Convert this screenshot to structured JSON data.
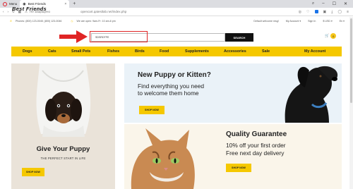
{
  "browser": {
    "tabs": [
      {
        "label": "Menu"
      },
      {
        "label": "Best Friends"
      }
    ],
    "not_secure": "Не защищено",
    "url": "opencart.qatestlab.net/index.php",
    "new_tab": "+"
  },
  "topbar": {
    "phone": "Phones: (800) 123-0045; (800) 123-0046",
    "hours": "We are open: 9am-Fr: 10 am-6 pm",
    "welcome": "Default welcome msg!",
    "account": "My Account",
    "signin": "Sign In",
    "currency": "$ USD",
    "language": "En"
  },
  "header": {
    "logo": "Best Friends",
    "search_value": "SDSRDTFE",
    "search_button": "SEARCH",
    "cart_count": "0"
  },
  "nav": {
    "items": [
      "Dogs",
      "Cats",
      "Small Pets",
      "Fishes",
      "Birds",
      "Food",
      "Supplements",
      "Accessories",
      "Sale",
      "My Account"
    ]
  },
  "hero_left": {
    "title": "Give Your Puppy",
    "subtitle": "THE PERFECT START IN LIFE",
    "button": "SHOP NOW"
  },
  "banner1": {
    "title": "New Puppy or Kitten?",
    "line1": "Find everything you need",
    "line2": "to welcome them home",
    "button": "SHOP NOW"
  },
  "banner2": {
    "title": "Quality Guarantee",
    "line1": "10% off your first order",
    "line2": "Free next day delivery",
    "button": "SHOP NOW"
  },
  "colors": {
    "accent": "#f5c800",
    "highlight": "#e02424"
  }
}
